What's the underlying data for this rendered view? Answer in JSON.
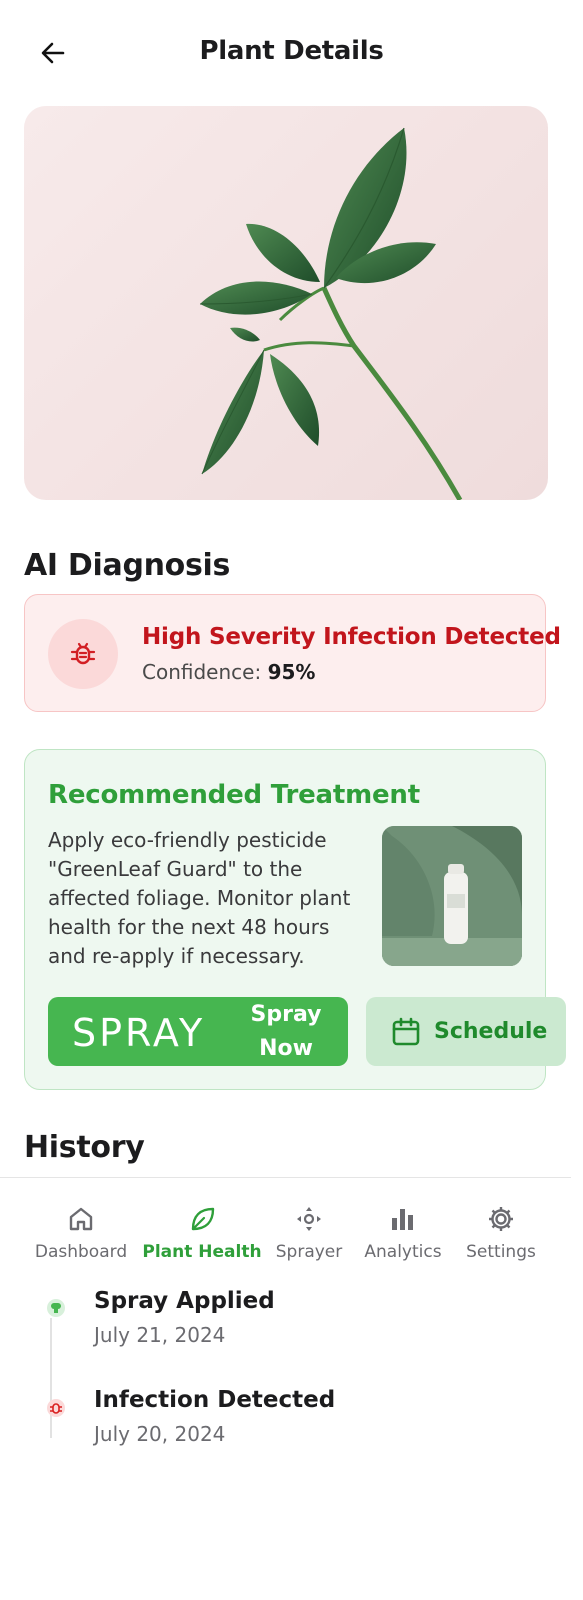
{
  "header": {
    "title": "Plant Details",
    "back_icon": "arrow-left-icon"
  },
  "diagnosis": {
    "section_title": "AI Diagnosis",
    "headline": "High Severity Infection Detected",
    "confidence_label": "Confidence:",
    "confidence_value": "95%",
    "icon": "bug-icon",
    "color": "#c2151c"
  },
  "treatment": {
    "title": "Recommended Treatment",
    "description": "Apply eco-friendly pesticide \"GreenLeaf Guard\" to the affected foliage. Monitor plant health for the next 48 hours and re-apply if necessary.",
    "spray_graphic_text": "SPRAY",
    "spray_button_label": "Spray Now",
    "schedule_button_label": "Schedule",
    "schedule_icon": "calendar-icon",
    "accent": "#46b650"
  },
  "history": {
    "section_title": "History",
    "events": [
      {
        "title": "Spray Applied",
        "date": "July 21, 2024",
        "icon": "spray-icon",
        "color": "#46b650"
      },
      {
        "title": "Infection Detected",
        "date": "July 20, 2024",
        "icon": "bug-icon",
        "color": "#d92020"
      }
    ]
  },
  "nav": {
    "items": [
      {
        "label": "Dashboard",
        "icon": "home-icon",
        "active": false
      },
      {
        "label": "Plant Health",
        "icon": "leaf-icon",
        "active": true
      },
      {
        "label": "Sprayer",
        "icon": "sprayer-icon",
        "active": false
      },
      {
        "label": "Analytics",
        "icon": "bar-chart-icon",
        "active": false
      },
      {
        "label": "Settings",
        "icon": "gear-icon",
        "active": false
      }
    ]
  }
}
